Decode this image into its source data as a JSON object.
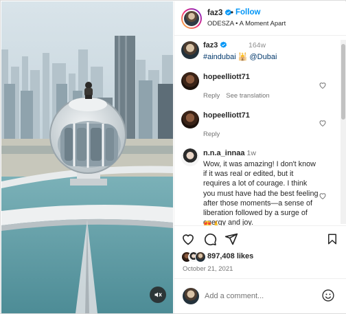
{
  "header": {
    "username": "faz3",
    "dot": "•",
    "follow_label": "Follow",
    "audio": "ODESZA • A Moment Apart"
  },
  "caption": {
    "username": "faz3",
    "time": "164w",
    "text": "#aindubai 🕌 @Dubai"
  },
  "comments": [
    {
      "username": "hopeelliott71",
      "reply_label": "Reply",
      "translate_label": "See translation"
    },
    {
      "username": "hopeelliott71",
      "reply_label": "Reply"
    },
    {
      "username": "n.n.a_innaa",
      "time": "1w",
      "text": "Wow, it was amazing! I don't know if it was real or edited, but it requires a lot of courage. I think you must have had the best feeling after those moments—a sense of liberation followed by a surge of energy and joy.",
      "emoji": "😍🙏"
    }
  ],
  "post": {
    "likes": "897,408 likes",
    "date": "October 21, 2021"
  },
  "add_comment": {
    "placeholder": "Add a comment..."
  },
  "colors": {
    "accent": "#0095f6",
    "hashtag": "#00376b",
    "muted": "#737373",
    "text": "#262626"
  },
  "icons": {
    "verified": "verified-badge-icon",
    "mute": "sound-off-icon",
    "like": "heart-icon",
    "comment": "comment-bubble-icon",
    "share": "paper-plane-icon",
    "save": "bookmark-icon",
    "emoji": "smiley-icon"
  }
}
